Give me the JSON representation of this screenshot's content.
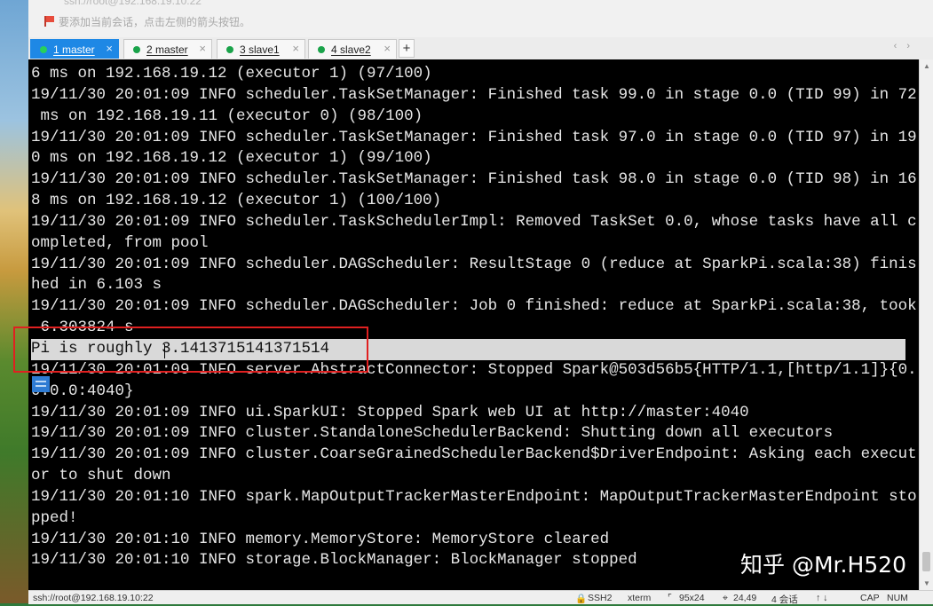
{
  "top_bar": {
    "session_path": "ssh://root@192.168.19.10:22",
    "hint": "要添加当前会话，点击左侧的箭头按钮。"
  },
  "tabs": [
    {
      "label": "1 master",
      "active": true
    },
    {
      "label": "2 master",
      "active": false
    },
    {
      "label": "3 slave1",
      "active": false
    },
    {
      "label": "4 slave2",
      "active": false
    }
  ],
  "tab_add_label": "+",
  "tab_close_label": "×",
  "tab_nav_label": "‹ ›",
  "terminal": {
    "lines": [
      "6 ms on 192.168.19.12 (executor 1) (97/100)",
      "19/11/30 20:01:09 INFO scheduler.TaskSetManager: Finished task 99.0 in stage 0.0 (TID 99) in 72",
      " ms on 192.168.19.11 (executor 0) (98/100)",
      "19/11/30 20:01:09 INFO scheduler.TaskSetManager: Finished task 97.0 in stage 0.0 (TID 97) in 19",
      "0 ms on 192.168.19.12 (executor 1) (99/100)",
      "19/11/30 20:01:09 INFO scheduler.TaskSetManager: Finished task 98.0 in stage 0.0 (TID 98) in 16",
      "8 ms on 192.168.19.12 (executor 1) (100/100)",
      "19/11/30 20:01:09 INFO scheduler.TaskSchedulerImpl: Removed TaskSet 0.0, whose tasks have all c",
      "ompleted, from pool",
      "19/11/30 20:01:09 INFO scheduler.DAGScheduler: ResultStage 0 (reduce at SparkPi.scala:38) finis",
      "hed in 6.103 s",
      "19/11/30 20:01:09 INFO scheduler.DAGScheduler: Job 0 finished: reduce at SparkPi.scala:38, took",
      " 6.303824 s",
      "Pi is roughly 3.1413715141371514",
      "19/11/30 20:01:09 INFO server.AbstractConnector: Stopped Spark@503d56b5{HTTP/1.1,[http/1.1]}{0.",
      "0.0.0:4040}",
      "19/11/30 20:01:09 INFO ui.SparkUI: Stopped Spark web UI at http://master:4040",
      "19/11/30 20:01:09 INFO cluster.StandaloneSchedulerBackend: Shutting down all executors",
      "19/11/30 20:01:09 INFO cluster.CoarseGrainedSchedulerBackend$DriverEndpoint: Asking each execut",
      "or to shut down",
      "19/11/30 20:01:10 INFO spark.MapOutputTrackerMasterEndpoint: MapOutputTrackerMasterEndpoint sto",
      "pped!",
      "19/11/30 20:01:10 INFO memory.MemoryStore: MemoryStore cleared",
      "19/11/30 20:01:10 INFO storage.BlockManager: BlockManager stopped"
    ],
    "highlighted_line_index": 13,
    "watermark": "知乎 @Mr.H520"
  },
  "status_bar": {
    "connection": "ssh://root@192.168.19.10:22",
    "protocol": "SSH2",
    "terminal_type": "xterm",
    "size": "95x24",
    "position": "24,49",
    "sessions": "4 会话",
    "nav_arrows": "↑ ↓",
    "caps": "CAP",
    "num": "NUM"
  },
  "colors": {
    "active_tab": "#1e88e5",
    "terminal_bg": "#000000",
    "terminal_fg": "#e6e6e6",
    "highlight_bg": "#d9d9d9",
    "annotation_box": "#e02020"
  }
}
